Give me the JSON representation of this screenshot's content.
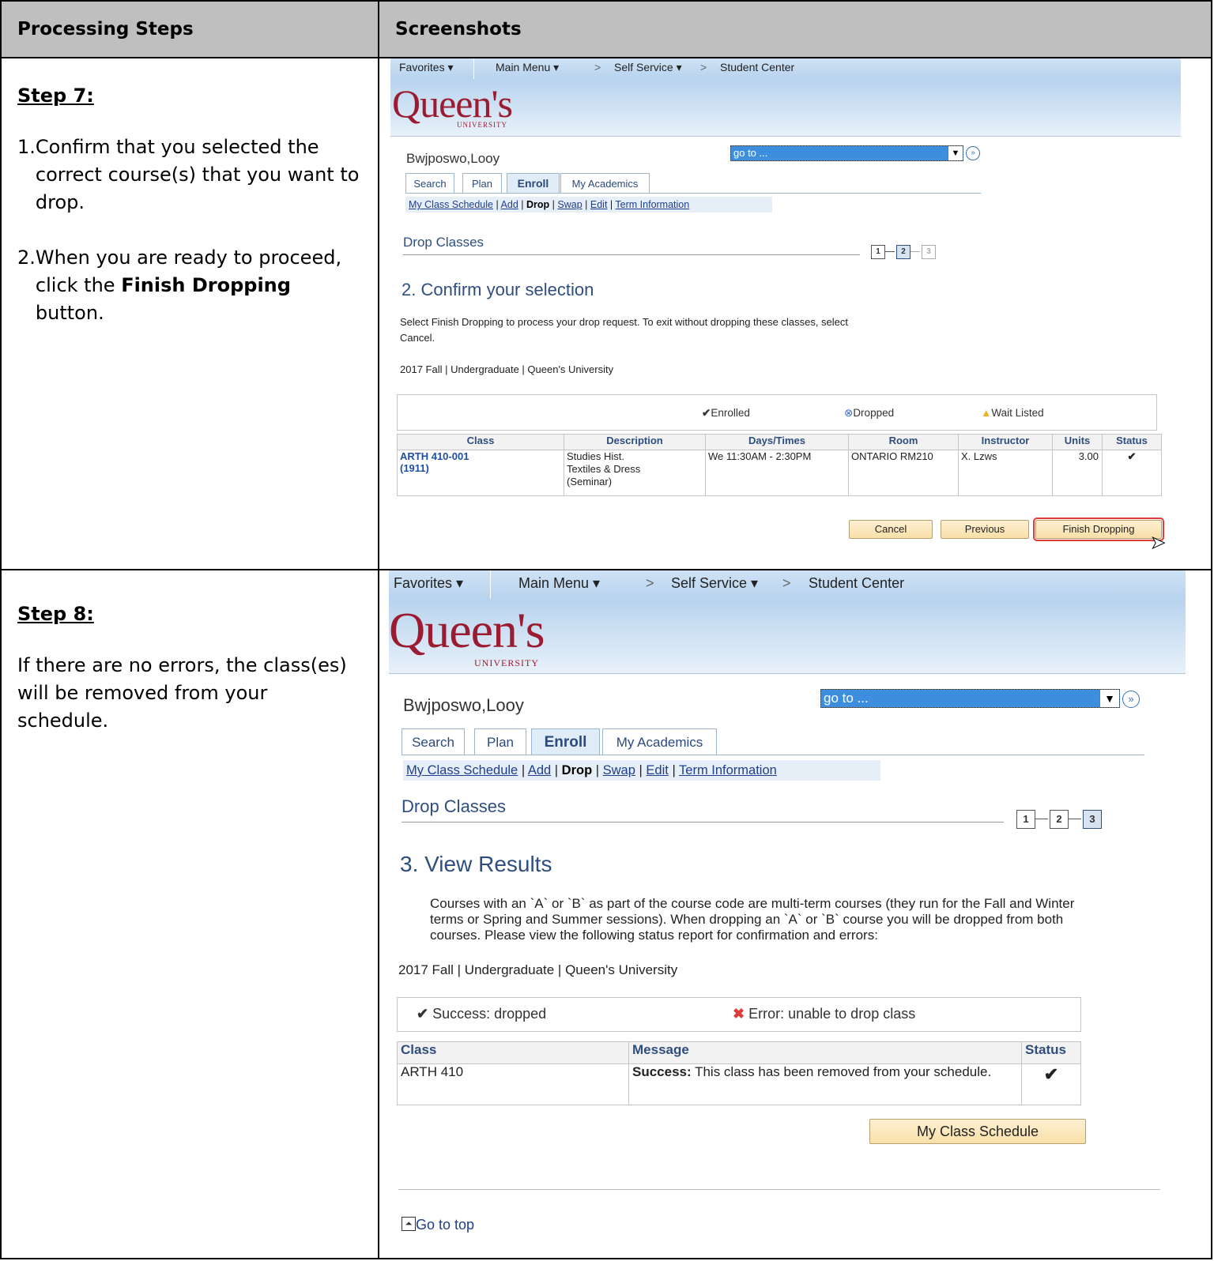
{
  "table_header": {
    "col1": "Processing Steps",
    "col2": "Screenshots"
  },
  "step7": {
    "title": "Step 7:",
    "item1": "Confirm that you selected the correct course(s) that you want to drop.",
    "item2_pre": "When you are ready to proceed, click the ",
    "item2_bold": "Finish Dropping",
    "item2_post": " button."
  },
  "step8": {
    "title": "Step 8:",
    "text": "If there are no errors, the class(es) will be removed from your schedule."
  },
  "nav": {
    "favorites": "Favorites ▾",
    "main_menu": "Main Menu ▾",
    "sep1": ">",
    "self_service": "Self Service ▾",
    "sep2": ">",
    "student_center": "Student Center"
  },
  "logo": {
    "text": "Queen's",
    "sub": "UNIVERSITY"
  },
  "student_name": "Bwjposwo,Looy",
  "goto": "go to ...",
  "tabs": {
    "search": "Search",
    "plan": "Plan",
    "enroll": "Enroll",
    "academics": "My Academics"
  },
  "subnav": {
    "schedule": "My Class Schedule",
    "add": "Add",
    "drop": "Drop",
    "swap": "Swap",
    "edit": "Edit",
    "term": "Term Information",
    "sep": "|"
  },
  "section_title": "Drop Classes",
  "steps": [
    "1",
    "2",
    "3"
  ],
  "shot1": {
    "heading": "2.  Confirm your selection",
    "instructions": "Select Finish Dropping to process your drop request. To exit without dropping these classes, select Cancel.",
    "term": "2017 Fall | Undergraduate | Queen's University",
    "legend": {
      "enrolled": "Enrolled",
      "dropped": "Dropped",
      "waitlisted": "Wait Listed"
    },
    "columns": [
      "Class",
      "Description",
      "Days/Times",
      "Room",
      "Instructor",
      "Units",
      "Status"
    ],
    "row": {
      "class_line1": "ARTH 410-001",
      "class_line2": "(1911)",
      "desc_line1": "Studies Hist.",
      "desc_line2": "Textiles & Dress",
      "desc_line3": "(Seminar)",
      "days": "We 11:30AM - 2:30PM",
      "room": "ONTARIO RM210",
      "instructor": "X. Lzws",
      "units": "3.00",
      "status": "✔"
    },
    "buttons": {
      "cancel": "Cancel",
      "previous": "Previous",
      "finish": "Finish Dropping"
    }
  },
  "shot2": {
    "heading": "3. View Results",
    "info": "Courses with an `A` or `B` as part of the course code are multi-term courses (they run for the Fall and Winter terms or Spring and Summer sessions). When dropping an `A` or `B` course you will be dropped from both courses. Please view the following status report for confirmation and errors:",
    "term": "2017 Fall | Undergraduate | Queen's University",
    "legend": {
      "success": "Success: dropped",
      "error": "Error: unable to drop class"
    },
    "columns": [
      "Class",
      "Message",
      "Status"
    ],
    "row": {
      "class": "ARTH  410",
      "msg_bold": "Success:",
      "msg": " This class has been removed from your schedule.",
      "status": "✔"
    },
    "button": "My Class Schedule",
    "go_top": "Go to top"
  },
  "colors": {
    "accent": "#2f4e80",
    "logo": "#9b1b30",
    "success": "#4caf20",
    "error": "#e03c3c"
  }
}
